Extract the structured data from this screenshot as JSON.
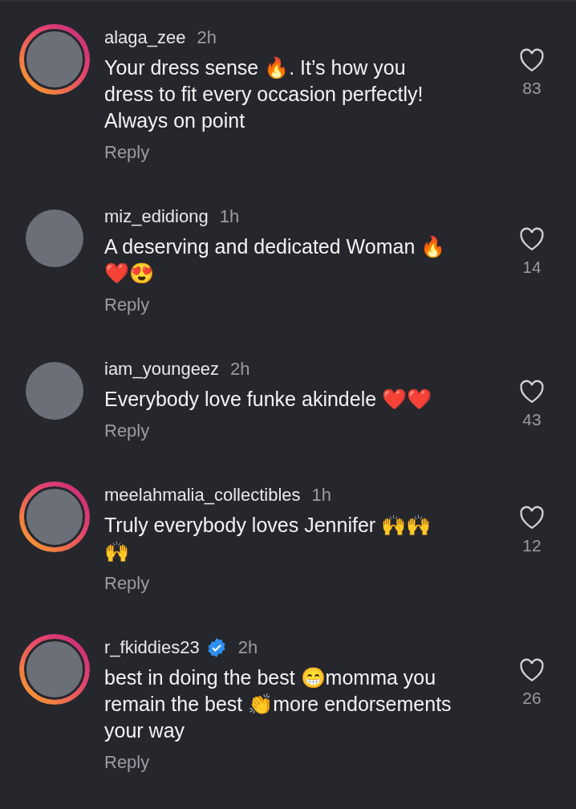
{
  "comments": [
    {
      "username": "alaga_zee",
      "verified": false,
      "story": true,
      "time": "2h",
      "text": "Your dress sense 🔥. It’s how you dress to fit every occasion perfectly! Always on point",
      "reply": "Reply",
      "likes": "83"
    },
    {
      "username": "miz_edidiong",
      "verified": false,
      "story": false,
      "time": "1h",
      "text": "A deserving and dedicated Woman 🔥❤️😍",
      "reply": "Reply",
      "likes": "14"
    },
    {
      "username": "iam_youngeez",
      "verified": false,
      "story": false,
      "time": "2h",
      "text": "Everybody love funke akindele ❤️❤️",
      "reply": "Reply",
      "likes": "43"
    },
    {
      "username": "meelahmalia_collectibles",
      "verified": false,
      "story": true,
      "time": "1h",
      "text": "Truly everybody loves Jennifer 🙌🙌 🙌",
      "reply": "Reply",
      "likes": "12"
    },
    {
      "username": "r_fkiddies23",
      "verified": true,
      "story": true,
      "time": "2h",
      "text": "best in doing the best 😁momma you remain the best 👏more endorsements your way",
      "reply": "Reply",
      "likes": "26"
    }
  ]
}
